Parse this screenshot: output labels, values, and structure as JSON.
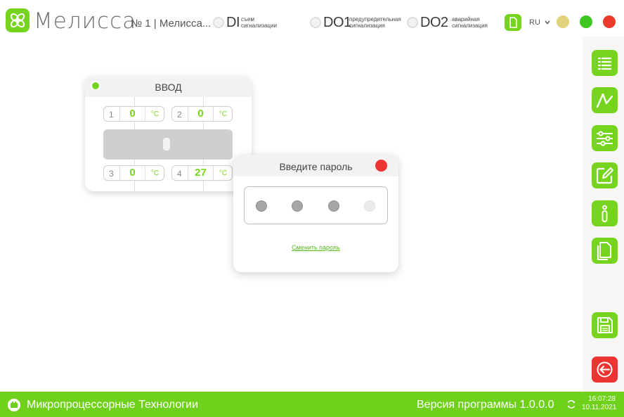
{
  "header": {
    "app_title": "Мелисса",
    "device": "№ 1 | Мелисса...",
    "signals": [
      {
        "name": "DI",
        "desc_line1": "съем",
        "desc_line2": "сигнализации"
      },
      {
        "name": "DO1",
        "desc_line1": "предупредительная",
        "desc_line2": "сигнализация"
      },
      {
        "name": "DO2",
        "desc_line1": "аварийная",
        "desc_line2": "сигнализация"
      }
    ],
    "language": "RU",
    "language_icon": "chevron-down-icon",
    "window_buttons": [
      {
        "name": "minimize",
        "color": "#e2d27c"
      },
      {
        "name": "maximize",
        "color": "#3cc61e"
      },
      {
        "name": "close",
        "color": "#ea3a2a"
      }
    ]
  },
  "toolbar": {
    "items": [
      {
        "icon": "list-icon"
      },
      {
        "icon": "graph-icon"
      },
      {
        "icon": "sliders-icon"
      },
      {
        "icon": "edit-icon"
      },
      {
        "icon": "info-icon"
      },
      {
        "icon": "documents-icon"
      },
      {
        "icon": "save-icon"
      },
      {
        "icon": "exit-icon"
      }
    ]
  },
  "widget": {
    "title": "ВВОД",
    "status_color": "#77d41e",
    "channels": [
      {
        "num": "1",
        "value": "0",
        "unit": "°C"
      },
      {
        "num": "2",
        "value": "0",
        "unit": "°C"
      },
      {
        "num": "3",
        "value": "0",
        "unit": "°C"
      },
      {
        "num": "4",
        "value": "27",
        "unit": "°C"
      }
    ]
  },
  "password_dialog": {
    "title": "Введите пароль",
    "pins_filled": 3,
    "pins_total": 4,
    "change_link": "Сменить пароль"
  },
  "footer": {
    "company": "Микропроцессорные Технологии",
    "version": "Версия программы  1.0.0.0",
    "time": "16:07:28",
    "date": "10.11.2021"
  },
  "colors": {
    "accent": "#77d41e",
    "footer": "#6fd11b",
    "danger": "#ee3333"
  }
}
